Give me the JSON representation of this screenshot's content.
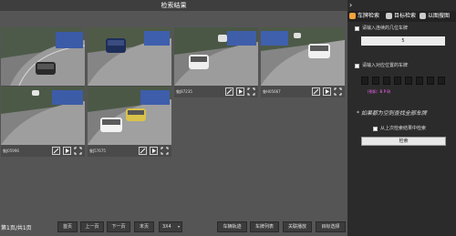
{
  "main": {
    "title": "检索结果",
    "thumbnails": [
      {
        "plate": "鲁J03156"
      },
      {
        "plate": "鲁J03586"
      },
      {
        "plate": "鲁J87235"
      },
      {
        "plate": "鲁H05667"
      },
      {
        "plate": "鲁J05996"
      },
      {
        "plate": "鲁J57675"
      }
    ]
  },
  "pager": {
    "info": "第1页/共1页",
    "buttons": [
      "首页",
      "上一页",
      "下一页",
      "末页"
    ],
    "size_select": "3X4",
    "actions": [
      "车辆轨迹",
      "车牌列表",
      "关联播放",
      "目标选择"
    ]
  },
  "panel": {
    "tabs": [
      "车牌检索",
      "目标检索",
      "以图搜图"
    ],
    "option1_label": "请输入连续的几位车牌",
    "option1_value": "5",
    "option2_label": "请输入对应位置的车牌",
    "option2_hint": "(例如：B   P         8)",
    "note": "* 如果都为空则查找全部车牌",
    "option3_label": "从上次检索结果中检索",
    "search_label": "检索"
  },
  "colors": {
    "accent": "#f2a33a",
    "hint": "#ff66ff"
  }
}
